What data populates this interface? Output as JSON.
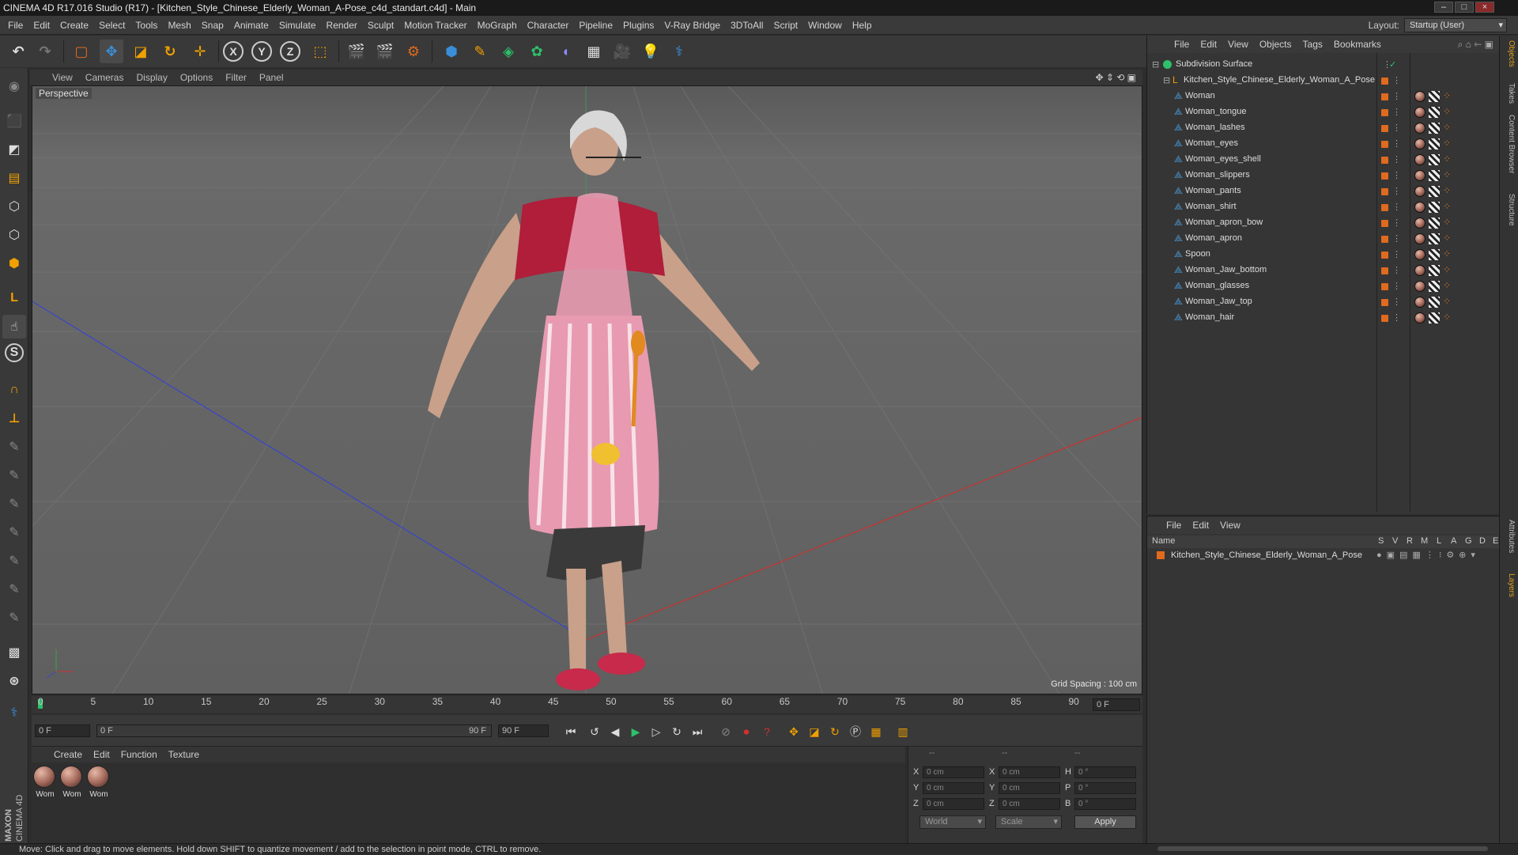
{
  "window": {
    "title": "CINEMA 4D R17.016 Studio (R17) - [Kitchen_Style_Chinese_Elderly_Woman_A-Pose_c4d_standart.c4d] - Main"
  },
  "menubar": {
    "items": [
      "File",
      "Edit",
      "Create",
      "Select",
      "Tools",
      "Mesh",
      "Snap",
      "Animate",
      "Simulate",
      "Render",
      "Sculpt",
      "Motion Tracker",
      "MoGraph",
      "Character",
      "Pipeline",
      "Plugins",
      "V-Ray Bridge",
      "3DToAll",
      "Script",
      "Window",
      "Help"
    ],
    "layout_label": "Layout:",
    "layout_value": "Startup (User)"
  },
  "viewport": {
    "menu": [
      "View",
      "Cameras",
      "Display",
      "Options",
      "Filter",
      "Panel"
    ],
    "camera_label": "Perspective",
    "grid_spacing": "Grid Spacing : 100 cm"
  },
  "timeline": {
    "ticks": [
      "0",
      "5",
      "10",
      "15",
      "20",
      "25",
      "30",
      "35",
      "40",
      "45",
      "50",
      "55",
      "60",
      "65",
      "70",
      "75",
      "80",
      "85",
      "90"
    ],
    "current_frame_field": "0 F",
    "start_field": "0 F",
    "range_start": "0 F",
    "range_end": "90 F",
    "end_field": "90 F"
  },
  "materials": {
    "menu": [
      "Create",
      "Edit",
      "Function",
      "Texture"
    ],
    "items": [
      "Wom",
      "Wom",
      "Wom"
    ]
  },
  "coordinates": {
    "header": [
      "--",
      "--",
      "--"
    ],
    "rows": [
      {
        "a": "X",
        "av": "0 cm",
        "b": "X",
        "bv": "0 cm",
        "c": "H",
        "cv": "0 °"
      },
      {
        "a": "Y",
        "av": "0 cm",
        "b": "Y",
        "bv": "0 cm",
        "c": "P",
        "cv": "0 °"
      },
      {
        "a": "Z",
        "av": "0 cm",
        "b": "Z",
        "bv": "0 cm",
        "c": "B",
        "cv": "0 °"
      }
    ],
    "world_dropdown": "World",
    "scale_dropdown": "Scale",
    "apply_label": "Apply"
  },
  "objects_panel": {
    "menu": [
      "File",
      "Edit",
      "View",
      "Objects",
      "Tags",
      "Bookmarks"
    ],
    "root": "Subdivision Surface",
    "group": "Kitchen_Style_Chinese_Elderly_Woman_A_Pose",
    "children": [
      "Woman",
      "Woman_tongue",
      "Woman_lashes",
      "Woman_eyes",
      "Woman_eyes_shell",
      "Woman_slippers",
      "Woman_pants",
      "Woman_shirt",
      "Woman_apron_bow",
      "Woman_apron",
      "Spoon",
      "Woman_Jaw_bottom",
      "Woman_glasses",
      "Woman_Jaw_top",
      "Woman_hair"
    ]
  },
  "layers_panel": {
    "menu": [
      "File",
      "Edit",
      "View"
    ],
    "columns": [
      "Name",
      "S",
      "V",
      "R",
      "M",
      "L",
      "A",
      "G",
      "D",
      "E"
    ],
    "row_name": "Kitchen_Style_Chinese_Elderly_Woman_A_Pose"
  },
  "side_tabs": [
    "Objects",
    "Takes",
    "Content Browser",
    "Structure",
    "Attributes",
    "Layers"
  ],
  "status": {
    "text": "Move: Click and drag to move elements. Hold down SHIFT to quantize movement / add to the selection in point mode, CTRL to remove."
  },
  "logo": {
    "line1": "MAXON",
    "line2": "CINEMA 4D"
  },
  "colors": {
    "accent_orange": "#e06a1e",
    "accent_blue": "#3a8fd8",
    "axis_x": "#c83232",
    "axis_z": "#3a46c8"
  }
}
